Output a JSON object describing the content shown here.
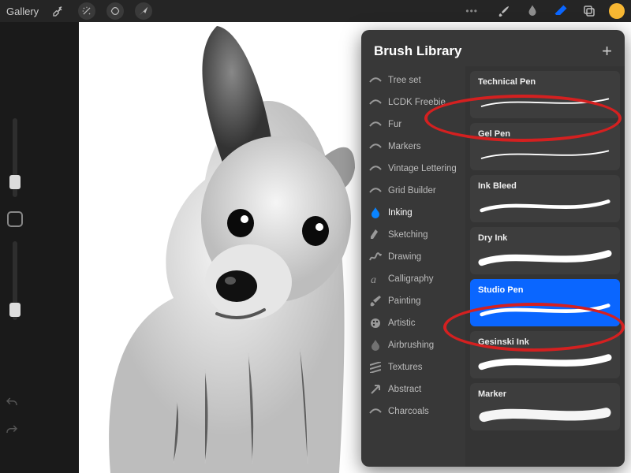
{
  "topbar": {
    "gallery_label": "Gallery"
  },
  "panel": {
    "title": "Brush Library"
  },
  "categories": [
    {
      "label": "Tree set",
      "icon": "stroke"
    },
    {
      "label": "LCDK Freebie",
      "icon": "stroke"
    },
    {
      "label": "Fur",
      "icon": "stroke"
    },
    {
      "label": "Markers",
      "icon": "stroke"
    },
    {
      "label": "Vintage Lettering",
      "icon": "stroke"
    },
    {
      "label": "Grid Builder",
      "icon": "stroke"
    },
    {
      "label": "Inking",
      "icon": "drop",
      "active": true
    },
    {
      "label": "Sketching",
      "icon": "pencil"
    },
    {
      "label": "Drawing",
      "icon": "squiggle"
    },
    {
      "label": "Calligraphy",
      "icon": "script"
    },
    {
      "label": "Painting",
      "icon": "brush"
    },
    {
      "label": "Artistic",
      "icon": "palette"
    },
    {
      "label": "Airbrushing",
      "icon": "drop2"
    },
    {
      "label": "Textures",
      "icon": "hatch"
    },
    {
      "label": "Abstract",
      "icon": "arrow"
    },
    {
      "label": "Charcoals",
      "icon": "stroke"
    }
  ],
  "brushes": [
    {
      "name": "Technical Pen",
      "style": "thin",
      "selected": false
    },
    {
      "name": "Gel Pen",
      "style": "thin",
      "selected": false
    },
    {
      "name": "Ink Bleed",
      "style": "med",
      "selected": false
    },
    {
      "name": "Dry Ink",
      "style": "thick",
      "selected": false
    },
    {
      "name": "Studio Pen",
      "style": "med",
      "selected": true
    },
    {
      "name": "Gesinski Ink",
      "style": "thick",
      "selected": false
    },
    {
      "name": "Marker",
      "style": "chunky",
      "selected": false
    }
  ],
  "colors": {
    "accent": "#0a66ff",
    "swatch": "#f7b733"
  }
}
